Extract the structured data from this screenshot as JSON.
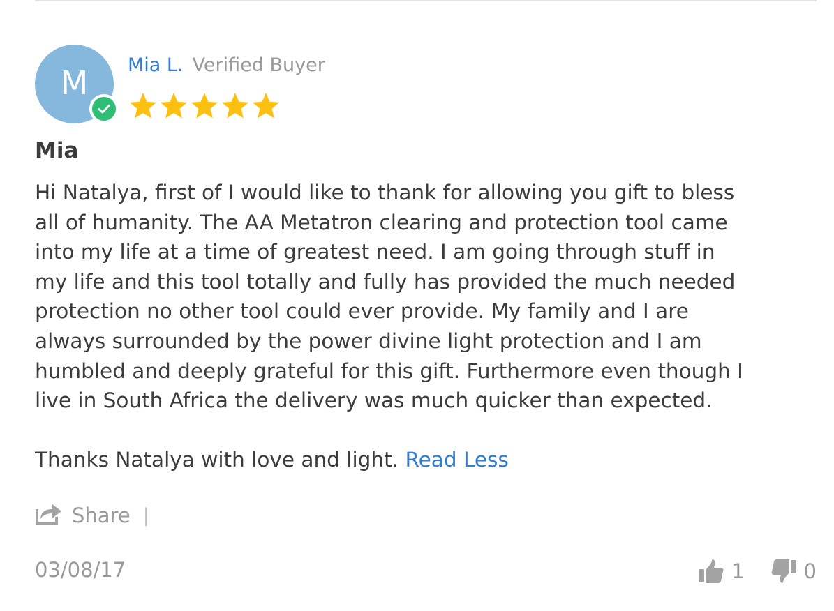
{
  "review": {
    "avatar_letter": "M",
    "author_name": "Mia L.",
    "verified_label": "Verified Buyer",
    "rating": 5,
    "rating_max": 5,
    "title": "Mia",
    "body_lines": [
      "Hi Natalya, first of I would like to thank for allowing you gift to bless",
      "all of humanity. The AA Metatron clearing and protection tool came",
      "into my life at a time of greatest need. I am going through stuff in",
      "my life and this tool totally and fully has provided the much needed",
      "protection no other tool could ever provide. My family and I are",
      "always surrounded by the power divine light protection and I am",
      "humbled and deeply grateful for this gift. Furthermore even though I",
      "live in South Africa the delivery was much quicker than expected."
    ],
    "closing_line": "Thanks Natalya with love and light.",
    "read_less_label": "Read Less",
    "share_label": "Share",
    "separator": "|",
    "date": "03/08/17",
    "votes_up": "1",
    "votes_down": "0"
  },
  "icons": {
    "avatar": "letter-avatar",
    "verified": "check-circle-icon",
    "star": "star-icon",
    "share": "share-icon",
    "thumbs_up": "thumbs-up-icon",
    "thumbs_down": "thumbs-down-icon"
  },
  "colors": {
    "avatar_bg": "#86b7dd",
    "verified_green": "#2dbd75",
    "link_blue": "#2f7dd8",
    "star_yellow": "#fcc110",
    "muted_gray": "#999999",
    "text": "#3c3c3c"
  }
}
